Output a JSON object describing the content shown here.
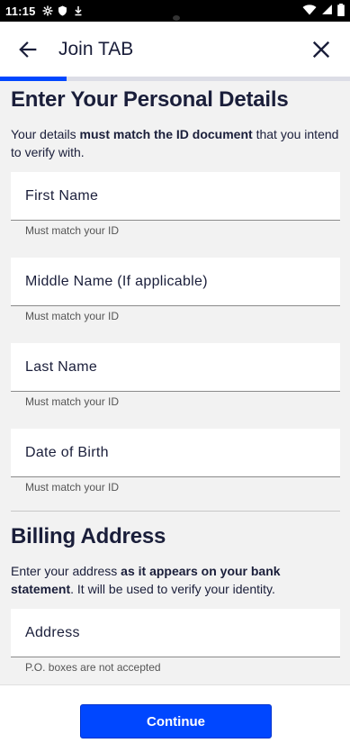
{
  "status_bar": {
    "time": "11:15",
    "icons": [
      "gear-icon",
      "shield-icon",
      "download-icon",
      "wifi-icon",
      "signal-icon",
      "battery-icon"
    ]
  },
  "app_bar": {
    "title": "Join TAB",
    "back_icon": "arrow-left-icon",
    "close_icon": "close-icon",
    "progress": 0.19
  },
  "personal": {
    "title": "Enter Your Personal Details",
    "desc_pre": "Your details ",
    "desc_bold": "must match the ID document",
    "desc_post": " that you intend to verify with.",
    "fields": [
      {
        "label": "First Name",
        "hint": "Must match your ID"
      },
      {
        "label": "Middle Name (If applicable)",
        "hint": "Must match your ID"
      },
      {
        "label": "Last Name",
        "hint": "Must match your ID"
      },
      {
        "label": "Date of Birth",
        "hint": "Must match your ID"
      }
    ]
  },
  "billing": {
    "title": "Billing Address",
    "desc_pre": "Enter your address ",
    "desc_bold": "as it appears on your bank statement",
    "desc_post": ". It will be used to verify your identity.",
    "address_label": "Address",
    "address_hint": "P.O. boxes are not accepted"
  },
  "footer": {
    "continue_label": "Continue"
  },
  "colors": {
    "accent": "#0047ff",
    "text": "#1a1e3a"
  }
}
